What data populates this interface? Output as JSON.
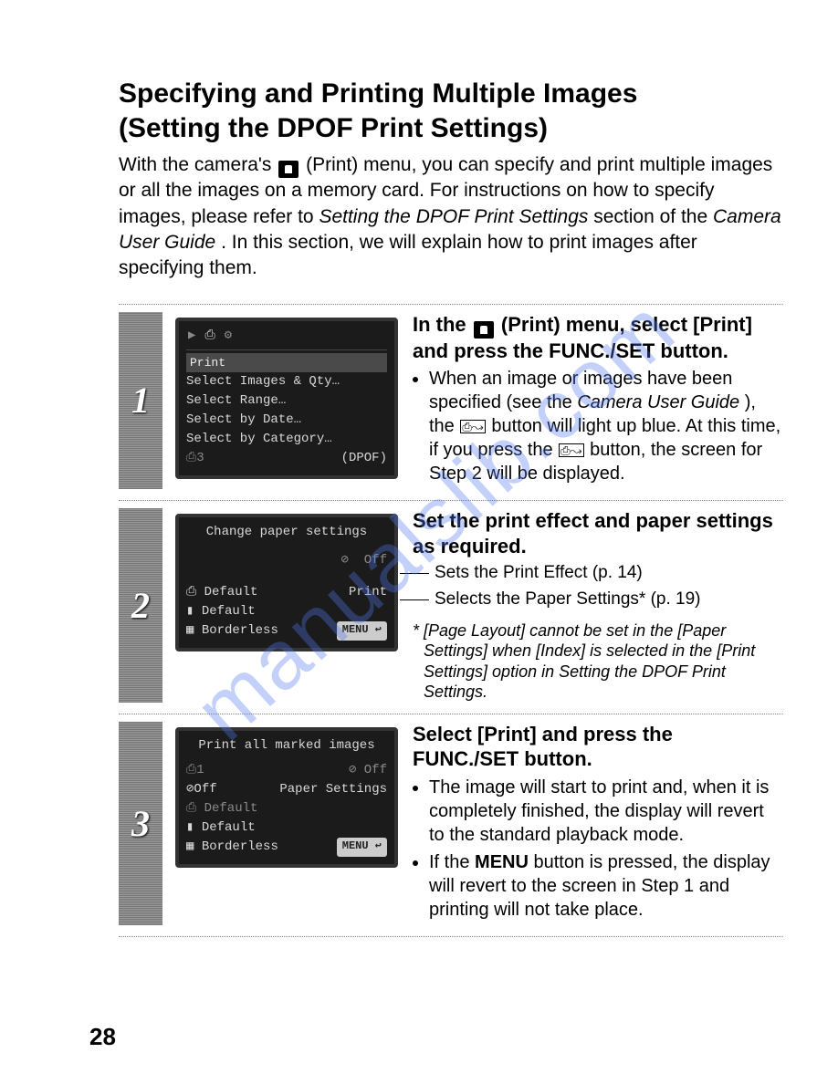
{
  "watermark": "manualslib.com",
  "title_line1": "Specifying and Printing Multiple Images",
  "title_line2": "(Setting the DPOF Print Settings)",
  "intro_before_icon": "With the camera's ",
  "intro_after_icon": "(Print) menu, you can specify and print multiple images or all the images on a memory card. For instructions on how to specify images, please refer to ",
  "intro_italic1": "Setting the DPOF Print Settings",
  "intro_mid": " section of the ",
  "intro_italic2": "Camera User Guide",
  "intro_end": ". In this section, we will explain how to print images after specifying them.",
  "steps": [
    {
      "num": "1",
      "lcd": {
        "tabs": [
          "▶",
          "⎙",
          "⚙"
        ],
        "header": "Print",
        "lines": [
          "Select Images & Qty…",
          "Select Range…",
          "Select by Date…",
          "Select by Category…"
        ],
        "bottom_left": "⎙3",
        "bottom_right": "(DPOF)"
      },
      "head_parts": {
        "a": "In the ",
        "b": " (Print) menu, select [Print] and press the FUNC./SET button."
      },
      "bullets": [
        {
          "pre": "When an image or images have been specified (see the ",
          "it": "Camera User Guide",
          "mid": "), the ",
          "post": " button will light up blue. At this time, if you press the ",
          "post2": " button, the screen for Step 2 will be displayed."
        }
      ]
    },
    {
      "num": "2",
      "lcd": {
        "title": "Change paper settings",
        "row1_left": "⊘",
        "row1_right": "Off",
        "rows": [
          [
            "⎙ Default",
            "Print"
          ],
          [
            "▮ Default",
            ""
          ],
          [
            "▦ Borderless",
            "MENU ↩"
          ]
        ]
      },
      "head": "Set the print effect and paper settings as required.",
      "callouts": [
        "Sets the Print Effect (p. 14)",
        "Selects the Paper Settings* (p. 19)"
      ],
      "footnote": "* [Page Layout] cannot be set in the [Paper Settings] when [Index] is selected in the [Print Settings] option in Setting the DPOF Print Settings."
    },
    {
      "num": "3",
      "lcd": {
        "title": "Print all marked images",
        "rows": [
          [
            "⎙1",
            "⊘ Off"
          ],
          [
            "⊘Off",
            "Paper Settings"
          ],
          [
            "⎙ Default",
            ""
          ],
          [
            "▮ Default",
            ""
          ],
          [
            "▦ Borderless",
            "MENU ↩"
          ]
        ]
      },
      "head": "Select [Print] and press the FUNC./SET button.",
      "bullets_plain": [
        "The image will start to print and, when it is completely finished, the display will revert to the standard playback mode.",
        {
          "pre": "If the ",
          "bold": "MENU",
          "post": " button is pressed, the display will revert to the screen in Step 1 and printing will not take place."
        }
      ]
    }
  ],
  "page_number": "28"
}
